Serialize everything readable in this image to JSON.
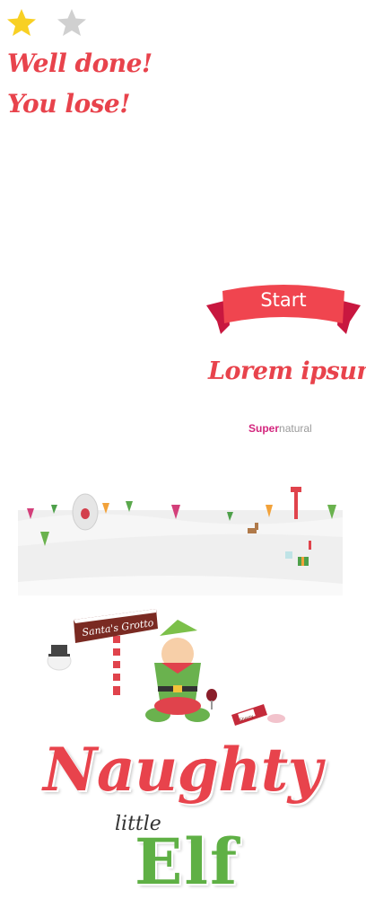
{
  "result": {
    "stars_earned": 1,
    "stars_total": 2,
    "line1": "Well done!",
    "line2": "You lose!"
  },
  "start_button": {
    "label": "Start"
  },
  "tagline": "Lorem ipsum",
  "sponsor": {
    "bold": "Super",
    "light": "natural"
  },
  "scene": {
    "grotto_sign": "Santa's Grotto",
    "bottle_label": "Sherry"
  },
  "title": {
    "word1": "Naughty",
    "word2": "little",
    "word3": "Elf"
  },
  "colors": {
    "accent": "#e8434c",
    "accent_dark": "#c8173f",
    "star_gold": "#f8d024",
    "star_grey": "#d0d0d0",
    "elf_green": "#5fb045",
    "sponsor_pink": "#d3257d"
  }
}
